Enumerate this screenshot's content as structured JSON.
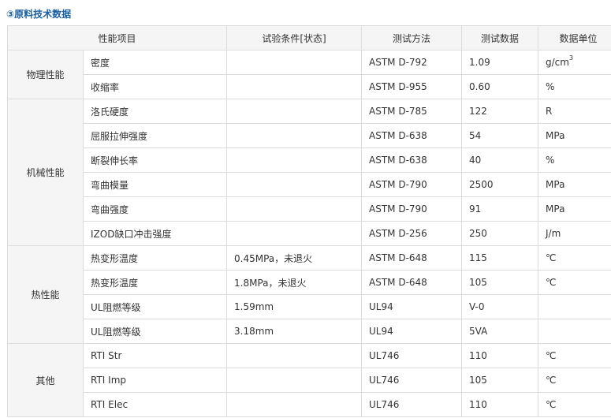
{
  "heading": "③原料技术数据",
  "columns": [
    "性能项目",
    "试验条件[状态]",
    "测试方法",
    "测试数据",
    "数据单位"
  ],
  "groups": [
    {
      "name": "物理性能",
      "rows": [
        {
          "item": "密度",
          "condition": "",
          "method": "ASTM D-792",
          "value": "1.09",
          "unit": "g/cm",
          "unit_sup": "3"
        },
        {
          "item": "收缩率",
          "condition": "",
          "method": "ASTM D-955",
          "value": "0.60",
          "unit": "%"
        }
      ]
    },
    {
      "name": "机械性能",
      "rows": [
        {
          "item": "洛氏硬度",
          "condition": "",
          "method": "ASTM D-785",
          "value": "122",
          "unit": "R"
        },
        {
          "item": "屈服拉伸强度",
          "condition": "",
          "method": "ASTM D-638",
          "value": "54",
          "unit": "MPa"
        },
        {
          "item": "断裂伸长率",
          "condition": "",
          "method": "ASTM D-638",
          "value": "40",
          "unit": "%"
        },
        {
          "item": "弯曲模量",
          "condition": "",
          "method": "ASTM D-790",
          "value": "2500",
          "unit": "MPa"
        },
        {
          "item": "弯曲强度",
          "condition": "",
          "method": "ASTM D-790",
          "value": "91",
          "unit": "MPa"
        },
        {
          "item": "IZOD缺口冲击强度",
          "condition": "",
          "method": "ASTM D-256",
          "value": "250",
          "unit": "J/m"
        }
      ]
    },
    {
      "name": "热性能",
      "rows": [
        {
          "item": "热变形温度",
          "condition": "0.45MPa，未退火",
          "method": "ASTM D-648",
          "value": "115",
          "unit": "℃"
        },
        {
          "item": "热变形温度",
          "condition": "1.8MPa，未退火",
          "method": "ASTM D-648",
          "value": "105",
          "unit": "℃"
        },
        {
          "item": "UL阻燃等级",
          "condition": "1.59mm",
          "method": "UL94",
          "value": "V-0",
          "unit": ""
        },
        {
          "item": "UL阻燃等级",
          "condition": "3.18mm",
          "method": "UL94",
          "value": "5VA",
          "unit": ""
        }
      ]
    },
    {
      "name": "其他",
      "rows": [
        {
          "item": "RTI Str",
          "condition": "",
          "method": "UL746",
          "value": "110",
          "unit": "℃"
        },
        {
          "item": "RTI Imp",
          "condition": "",
          "method": "UL746",
          "value": "105",
          "unit": "℃"
        },
        {
          "item": "RTI Elec",
          "condition": "",
          "method": "UL746",
          "value": "110",
          "unit": "℃"
        }
      ]
    }
  ],
  "colors": {
    "heading": "#1a5fa0",
    "header_bg": "#f5f5f5",
    "border": "#dcdcdc",
    "text": "#333333"
  }
}
